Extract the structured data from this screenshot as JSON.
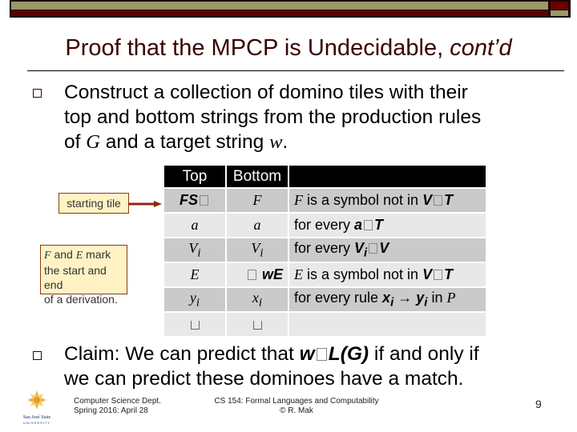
{
  "slide": {
    "title": "Proof that the MPCP is Undecidable, ",
    "title_italic": "cont’d",
    "page_number": "9"
  },
  "bullets": [
    {
      "line1": "Construct a collection of domino tiles with their",
      "line2": "top and bottom strings from the production rules",
      "line3_a": "of ",
      "line3_G": "G",
      "line3_b": " and a target string ",
      "line3_w": "w",
      "line3_c": "."
    },
    {
      "line1_a": "Claim: We can predict that ",
      "line1_w": "w",
      "line1_L": "L",
      "line1_G": "(G)",
      "line1_b": " if and only if",
      "line2": "we can predict these dominoes have a match."
    }
  ],
  "table": {
    "headers": [
      "Top",
      "Bottom",
      ""
    ],
    "rows": [
      {
        "top": "FS",
        "bottom": "F",
        "desc_sym": "F",
        "desc": " is a symbol not in ",
        "desc_math": "V",
        "desc_math2": "T"
      },
      {
        "top": "a",
        "bottom": "a",
        "desc": "for every ",
        "desc_math": "a",
        "desc_math2": "T"
      },
      {
        "top": "V",
        "top_sub": "i",
        "bottom": "V",
        "bottom_sub": "i",
        "desc": "for every ",
        "desc_math": "V",
        "desc_math_sub": "i",
        "desc_math2": "V"
      },
      {
        "top": "E",
        "bottom": "wE",
        "desc_sym": "E",
        "desc": " is a symbol not in ",
        "desc_math": "V",
        "desc_math2": "T"
      },
      {
        "top": "y",
        "top_sub": "i",
        "bottom": "x",
        "bottom_sub": "i",
        "desc": "for every rule ",
        "desc_x": "x",
        "desc_arrow": "→",
        "desc_y": "y",
        "desc_sub": "i",
        "desc_in": " in ",
        "desc_P": "P"
      },
      {
        "top": "",
        "bottom": "",
        "desc": ""
      }
    ]
  },
  "callouts": {
    "starting_tile": "starting tile",
    "marks_F": "F",
    "marks_and": " and ",
    "marks_E": "E",
    "marks_rest": " mark",
    "marks_line2": "the start and end",
    "marks_line3": "of a derivation."
  },
  "footer": {
    "dept": "Computer Science Dept.",
    "date": "Spring 2016: April 28",
    "course": "CS 154: Formal Languages and Computability",
    "author": "© R. Mak",
    "logo_text": "San José State",
    "logo_sub": "UNIVERSITY"
  },
  "colors": {
    "title": "#3a0000",
    "bar_olive": "#9a9868",
    "bar_maroon": "#5e0000",
    "callout_bg": "#fff3c4",
    "arrow": "#8b2a10"
  }
}
